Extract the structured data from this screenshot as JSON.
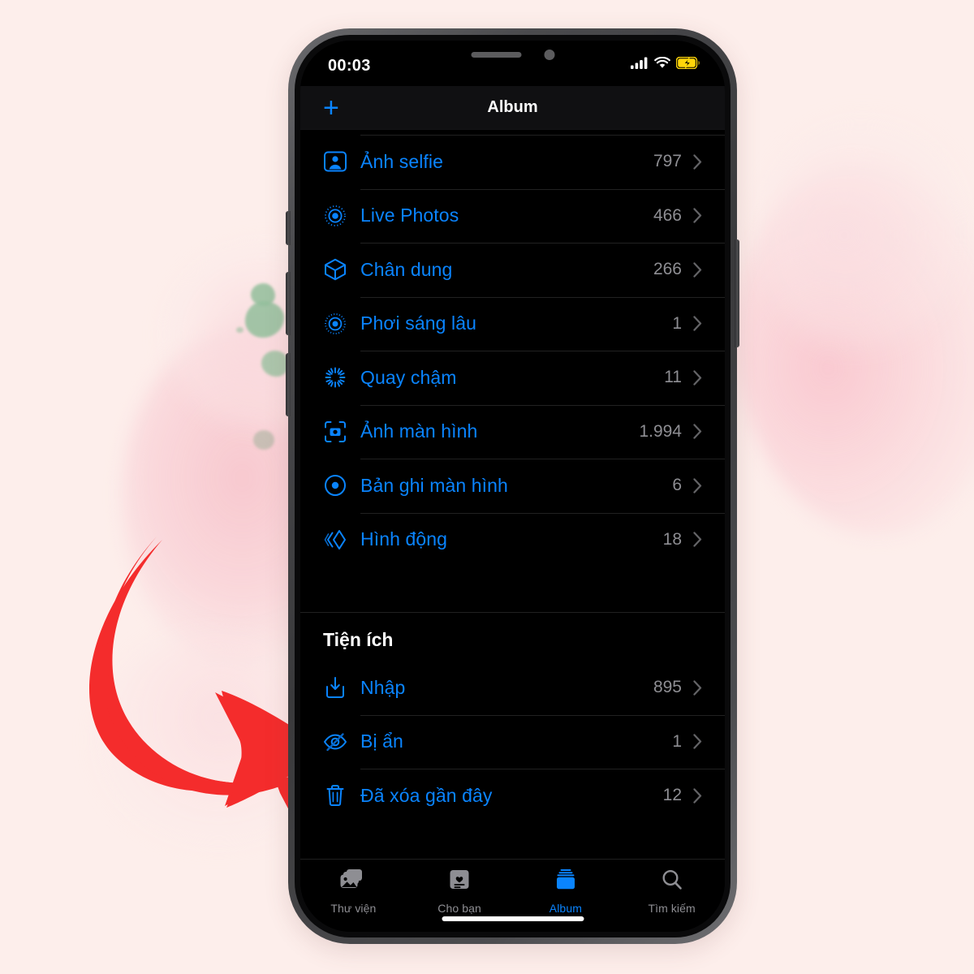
{
  "background": {
    "base_color": "#fdeeeb",
    "blot_pink": "#f7c6cd",
    "blot_green": "#93bf9c",
    "arrow_color": "#f42c2c"
  },
  "annotation": {
    "arrow_name": "curved-red-arrow",
    "points_to": "Đã xóa gần đây"
  },
  "phone": {
    "frame_color": "#4a4a4d",
    "screen_color": "#000000"
  },
  "status_bar": {
    "time": "00:03",
    "cellular_icon": "signal-bars-icon",
    "cellular_bars": 4,
    "wifi_icon": "wifi-icon",
    "battery_icon": "battery-charging-icon",
    "battery_color": "#ffd60a"
  },
  "nav_bar": {
    "add_label": "+",
    "title": "Album",
    "accent": "#0a84ff"
  },
  "media_types": {
    "items": [
      {
        "label": "Ảnh selfie",
        "count": "797",
        "icon": "selfie-portrait-icon"
      },
      {
        "label": "Live Photos",
        "count": "466",
        "icon": "live-photo-icon"
      },
      {
        "label": "Chân dung",
        "count": "266",
        "icon": "cube-portrait-icon"
      },
      {
        "label": "Phơi sáng lâu",
        "count": "1",
        "icon": "long-exposure-icon"
      },
      {
        "label": "Quay chậm",
        "count": "11",
        "icon": "slow-motion-icon"
      },
      {
        "label": "Ảnh màn hình",
        "count": "1.994",
        "icon": "screenshot-icon"
      },
      {
        "label": "Bản ghi màn hình",
        "count": "6",
        "icon": "screen-recording-icon"
      },
      {
        "label": "Hình động",
        "count": "18",
        "icon": "animated-bounce-icon"
      }
    ]
  },
  "utilities": {
    "header": "Tiện ích",
    "items": [
      {
        "label": "Nhập",
        "count": "895",
        "icon": "import-icon"
      },
      {
        "label": "Bị ẩn",
        "count": "1",
        "icon": "eye-slash-icon"
      },
      {
        "label": "Đã xóa gần đây",
        "count": "12",
        "icon": "trash-icon"
      }
    ]
  },
  "tab_bar": {
    "active_index": 2,
    "tabs": [
      {
        "label": "Thư viện",
        "icon": "photos-library-icon"
      },
      {
        "label": "Cho bạn",
        "icon": "for-you-icon"
      },
      {
        "label": "Album",
        "icon": "albums-icon"
      },
      {
        "label": "Tìm kiếm",
        "icon": "search-icon"
      }
    ]
  }
}
